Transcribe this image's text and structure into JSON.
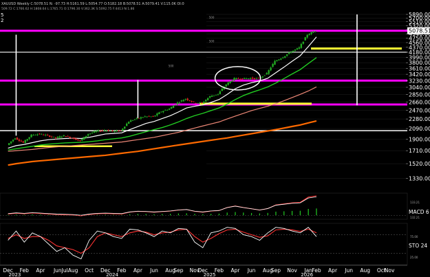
{
  "header": {
    "line1": "XAUUSD Weekly  C:5078.51  N: -97.73  H:5161.59  L:5054.77  O:5182.18  B:5078.51  A:5079.41  V:115.0K  OI:0",
    "line2": "509.72  C:1766.62  H:1808.64  L:1765.71  O:1796.30  V:362.3K  S:5092.75  F:4413  N:1.86",
    "frag_left_top": "5",
    "frag_left_bottom": "2"
  },
  "colors": {
    "background": "#000000",
    "candle_up": "#22aa22",
    "candle_down": "#dd2222",
    "ma_white": "#ffffff",
    "ma_green": "#22cc22",
    "ma_salmon": "#ee8877",
    "ma_orange": "#ff6a00",
    "magenta": "#ff00ff",
    "yellow": "#ffff33",
    "macd_red": "#ff3333",
    "stoch_red": "#ff3333",
    "grid": "#555555"
  },
  "chart_data": {
    "type": "candlestick",
    "price_axis": {
      "scale": "log",
      "ylim": [
        1200,
        6000
      ],
      "ticks": [
        "5890.00",
        "5700.00",
        "5510.00",
        "5320.00",
        "5130.00",
        "4940.00",
        "4750.00",
        "4560.00",
        "4370.00",
        "4180.00",
        "3990.00",
        "3800.00",
        "3610.00",
        "3420.00",
        "3230.00",
        "3040.00",
        "2850.00",
        "2660.00",
        "2470.00",
        "2280.00",
        "2090.00",
        "1900.00",
        "1710.00",
        "1520.00",
        "1330.00"
      ],
      "last_price_label": "5078.51"
    },
    "time_axis": {
      "labels": [
        "Dec",
        "Feb",
        "Apr",
        "JunJul",
        "Aug",
        "Oct",
        "Dec",
        "Feb",
        "Apr",
        "Jun",
        "Aug",
        "Sep",
        "Nov",
        "Dec",
        "Feb",
        "Apr",
        "Jun",
        "Aug",
        "Sep",
        "Nov",
        "Jan",
        "Feb",
        "Apr",
        "Jun",
        "Aug",
        "Oct",
        "Nov"
      ],
      "label_positions": [
        "2022-12",
        "2023-02",
        "2023-04",
        "2023-06.5",
        "2023-08",
        "2023-10",
        "2023-12",
        "2024-02",
        "2024-04",
        "2024-06",
        "2024-08",
        "2024-09",
        "2024-11",
        "2024-12",
        "2025-02",
        "2025-04",
        "2025-06",
        "2025-08",
        "2025-09",
        "2025-11",
        "2026-01",
        "2026-02",
        "2026-04",
        "2026-06",
        "2026-08",
        "2026-10",
        "2026-11"
      ],
      "year_labels": [
        "2023",
        "2024",
        "2025",
        "2026"
      ]
    },
    "price_series": {
      "dates": [
        "2022-12",
        "2023-01",
        "2023-02",
        "2023-03",
        "2023-04",
        "2023-05",
        "2023-06",
        "2023-07",
        "2023-08",
        "2023-09",
        "2023-10",
        "2023-11",
        "2023-12",
        "2024-01",
        "2024-02",
        "2024-03",
        "2024-04",
        "2024-05",
        "2024-06",
        "2024-07",
        "2024-08",
        "2024-09",
        "2024-10",
        "2024-11",
        "2024-12",
        "2025-01",
        "2025-02",
        "2025-03",
        "2025-04",
        "2025-05",
        "2025-06",
        "2025-07",
        "2025-08",
        "2025-09",
        "2025-10",
        "2025-11",
        "2025-12",
        "2026-01",
        "2026-02"
      ],
      "close": [
        1800,
        1920,
        1840,
        1970,
        1990,
        1960,
        1920,
        1960,
        1920,
        1870,
        1990,
        2040,
        2060,
        2040,
        2050,
        2230,
        2290,
        2330,
        2330,
        2440,
        2500,
        2640,
        2740,
        2650,
        2630,
        2800,
        2860,
        3120,
        3290,
        3290,
        3300,
        3290,
        3440,
        3850,
        4000,
        4200,
        4350,
        4900,
        5078.51
      ]
    },
    "moving_averages": [
      {
        "values": [
          1750,
          1790,
          1810,
          1840,
          1870,
          1890,
          1900,
          1910,
          1915,
          1910,
          1930,
          1960,
          1990,
          2000,
          2010,
          2070,
          2130,
          2190,
          2230,
          2290,
          2350,
          2430,
          2520,
          2560,
          2590,
          2650,
          2720,
          2850,
          3000,
          3100,
          3170,
          3220,
          3300,
          3470,
          3650,
          3850,
          4050,
          4400,
          4800
        ]
      },
      {
        "values": [
          1720,
          1740,
          1760,
          1780,
          1800,
          1815,
          1825,
          1835,
          1840,
          1845,
          1855,
          1870,
          1890,
          1905,
          1920,
          1950,
          1990,
          2030,
          2070,
          2110,
          2160,
          2220,
          2290,
          2350,
          2400,
          2460,
          2520,
          2610,
          2720,
          2820,
          2900,
          2970,
          3050,
          3160,
          3290,
          3430,
          3570,
          3770,
          3980
        ]
      },
      {
        "values": [
          1700,
          1710,
          1720,
          1730,
          1745,
          1760,
          1770,
          1780,
          1790,
          1800,
          1810,
          1820,
          1830,
          1840,
          1850,
          1870,
          1890,
          1910,
          1930,
          1960,
          1990,
          2020,
          2060,
          2100,
          2140,
          2180,
          2220,
          2280,
          2340,
          2400,
          2460,
          2510,
          2560,
          2620,
          2690,
          2770,
          2850,
          2940,
          3050
        ]
      },
      {
        "values": [
          1500,
          1520,
          1535,
          1550,
          1560,
          1570,
          1580,
          1590,
          1600,
          1610,
          1620,
          1630,
          1640,
          1655,
          1670,
          1685,
          1700,
          1720,
          1740,
          1760,
          1780,
          1800,
          1820,
          1840,
          1860,
          1880,
          1900,
          1920,
          1945,
          1970,
          1995,
          2020,
          2045,
          2070,
          2100,
          2130,
          2160,
          2200,
          2240
        ]
      }
    ],
    "horizontal_levels": [
      {
        "price": 5078.51
      },
      {
        "price": 4320
      },
      {
        "price": 4180
      },
      {
        "price": 3230
      },
      {
        "price": 2600
      },
      {
        "price": 2620
      },
      {
        "price": 2050
      },
      {
        "price": 1780
      }
    ],
    "vertical_markers": [
      {
        "date": "2023-01",
        "from_price": 1960,
        "to_price": 4900
      },
      {
        "date": "2024-04",
        "from_price": 2300,
        "to_price": 3250
      },
      {
        "date": "2026-07",
        "from_price": 2580,
        "to_price": 5890
      }
    ],
    "annotations": {
      "ellipse": {
        "date": "2025-06",
        "price": 3300
      },
      "small_labels": [
        {
          "text": "500",
          "date": "2025-05",
          "price": 5680
        },
        {
          "text": "500",
          "date": "2025-05",
          "price": 4580
        },
        {
          "text": "500",
          "date": "2024-12",
          "price": 3650
        }
      ]
    },
    "macd": {
      "label": "MACD 6",
      "axis_labels": [
        "133.21",
        "132.21"
      ],
      "values": [
        5,
        8,
        6,
        9,
        7,
        5,
        3,
        2,
        1,
        -2,
        3,
        6,
        7,
        6,
        5,
        12,
        15,
        14,
        12,
        14,
        16,
        20,
        22,
        15,
        12,
        16,
        18,
        30,
        36,
        30,
        25,
        20,
        26,
        40,
        44,
        48,
        50,
        70,
        75
      ]
    },
    "stochastic": {
      "label": "STO 24",
      "axis_labels": [
        "75.00",
        "25.00"
      ],
      "k": [
        60,
        85,
        55,
        80,
        70,
        50,
        30,
        40,
        20,
        10,
        60,
        85,
        80,
        70,
        65,
        90,
        88,
        80,
        70,
        85,
        80,
        92,
        90,
        55,
        40,
        80,
        85,
        95,
        92,
        75,
        70,
        60,
        80,
        95,
        92,
        85,
        80,
        95,
        70
      ],
      "d": [
        65,
        75,
        65,
        70,
        70,
        60,
        45,
        40,
        35,
        25,
        40,
        70,
        80,
        75,
        70,
        80,
        85,
        82,
        75,
        80,
        82,
        88,
        90,
        70,
        55,
        65,
        78,
        88,
        90,
        82,
        75,
        68,
        72,
        88,
        90,
        88,
        84,
        90,
        80
      ]
    }
  }
}
